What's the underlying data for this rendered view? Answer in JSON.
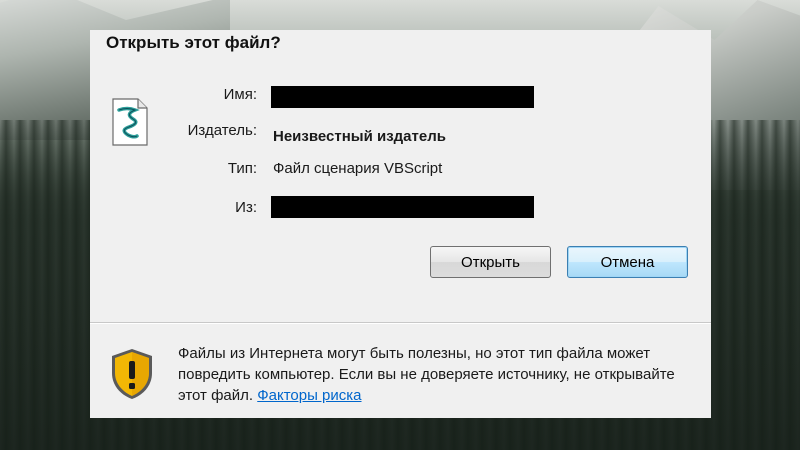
{
  "dialog": {
    "title": "Открыть этот файл?",
    "fields": {
      "name_label": "Имя:",
      "publisher_label": "Издатель:",
      "publisher_value": "Неизвестный издатель",
      "type_label": "Тип:",
      "type_value": "Файл сценария VBScript",
      "from_label": "Из:"
    },
    "buttons": {
      "open": "Открыть",
      "cancel": "Отмена"
    },
    "warning": {
      "text": "Файлы из Интернета могут быть полезны, но этот тип файла может повредить компьютер. Если вы не доверяете источнику, не открывайте этот файл. ",
      "link": "Факторы риска"
    },
    "icons": {
      "file": "vbscript-file-icon",
      "warning": "shield-warning-icon"
    },
    "colors": {
      "dialog_bg": "#f0f0f0",
      "link": "#0066cc",
      "shield_yellow": "#f2b705"
    }
  }
}
